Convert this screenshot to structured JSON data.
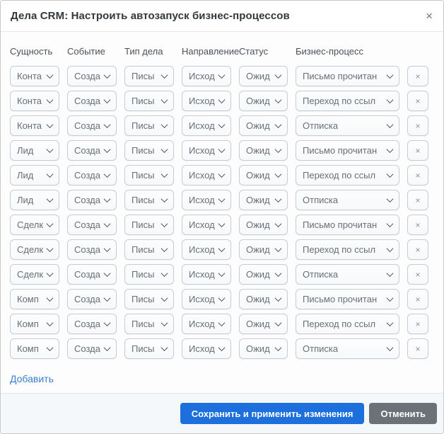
{
  "modal": {
    "title": "Дела CRM: Настроить автозапуск бизнес-процессов",
    "close_label": "×"
  },
  "table": {
    "headers": [
      "Сущность",
      "Событие",
      "Тип дела",
      "Направление",
      "Статус",
      "Бизнес-процесс"
    ],
    "remove_label": "×",
    "rows": [
      {
        "entity": "Конта",
        "event": "Созда",
        "type": "Писы",
        "direction": "Исход",
        "status": "Ожид",
        "process": "Письмо прочитан"
      },
      {
        "entity": "Конта",
        "event": "Созда",
        "type": "Писы",
        "direction": "Исход",
        "status": "Ожид",
        "process": "Переход по ссыл"
      },
      {
        "entity": "Конта",
        "event": "Созда",
        "type": "Писы",
        "direction": "Исход",
        "status": "Ожид",
        "process": "Отписка"
      },
      {
        "entity": "Лид",
        "event": "Созда",
        "type": "Писы",
        "direction": "Исход",
        "status": "Ожид",
        "process": "Письмо прочитан"
      },
      {
        "entity": "Лид",
        "event": "Созда",
        "type": "Писы",
        "direction": "Исход",
        "status": "Ожид",
        "process": "Переход по ссыл"
      },
      {
        "entity": "Лид",
        "event": "Созда",
        "type": "Писы",
        "direction": "Исход",
        "status": "Ожид",
        "process": "Отписка"
      },
      {
        "entity": "Сделк",
        "event": "Созда",
        "type": "Писы",
        "direction": "Исход",
        "status": "Ожид",
        "process": "Письмо прочитан"
      },
      {
        "entity": "Сделк",
        "event": "Созда",
        "type": "Писы",
        "direction": "Исход",
        "status": "Ожид",
        "process": "Переход по ссыл"
      },
      {
        "entity": "Сделк",
        "event": "Созда",
        "type": "Писы",
        "direction": "Исход",
        "status": "Ожид",
        "process": "Отписка"
      },
      {
        "entity": "Комп",
        "event": "Созда",
        "type": "Писы",
        "direction": "Исход",
        "status": "Ожид",
        "process": "Письмо прочитан"
      },
      {
        "entity": "Комп",
        "event": "Созда",
        "type": "Писы",
        "direction": "Исход",
        "status": "Ожид",
        "process": "Переход по ссыл"
      },
      {
        "entity": "Комп",
        "event": "Созда",
        "type": "Писы",
        "direction": "Исход",
        "status": "Ожид",
        "process": "Отписка"
      }
    ]
  },
  "add_link_label": "Добавить",
  "footer": {
    "save_label": "Сохранить и применить изменения",
    "cancel_label": "Отменить"
  },
  "colors": {
    "primary_button": "#1c6fdc",
    "secondary_button": "#6b7177",
    "link": "#3b80cf"
  }
}
